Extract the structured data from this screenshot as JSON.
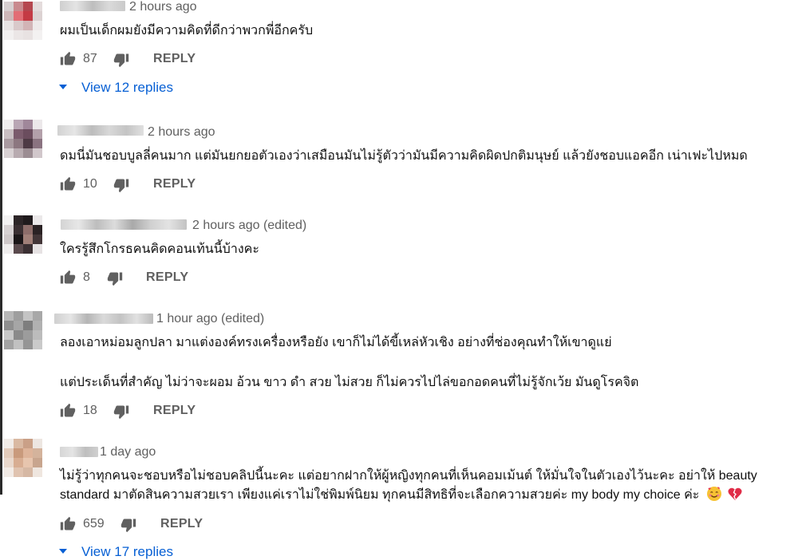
{
  "comments": [
    {
      "time": "2 hours ago",
      "text_lines": [
        "ผมเป็นเด็กผมยังมีความคิดที่ดีกว่าพวกพี่อีกครับ"
      ],
      "likes": "87",
      "reply_label": "REPLY",
      "view_replies": "View 12 replies"
    },
    {
      "time": "2 hours ago",
      "text_lines": [
        "ดมนี่มันชอบบูลลี่คนมาก แต่มันยกยอตัวเองว่าเสมือนมันไม่รู้ตัวว่ามันมีความคิดผิดปกติมนุษย์ แล้วยังชอบแอคอีก เน่าเฟะไปหมด"
      ],
      "likes": "10",
      "reply_label": "REPLY"
    },
    {
      "time": "2 hours ago (edited)",
      "text_lines": [
        "ใครรู้สึกโกรธคนคิดคอนเท้นนี้บ้างคะ"
      ],
      "likes": "8",
      "reply_label": "REPLY"
    },
    {
      "time": "1 hour ago (edited)",
      "text_lines": [
        "ลองเอาหม่อมลูกปลา มาแต่งองค์ทรงเครื่องหรือยัง เขาก็ไม่ได้ขี้เหล่หัวเชิง อย่างที่ช่องคุณทำให้เขาดูแย่",
        "แต่ประเด็นที่สำคัญ ไม่ว่าจะผอม อ้วน ขาว ดำ สวย ไม่สวย  ก็ไม่ควรไปไล่ขอกอดคนที่ไม่รู้จักเว้ย มันดูโรคจิต"
      ],
      "likes": "18",
      "reply_label": "REPLY"
    },
    {
      "time": "1 day ago",
      "text_lines": [
        "ไม่รู้ว่าทุกคนจะชอบหรือไม่ชอบคลิปนี้นะคะ แต่อยากฝากให้ผู้หญิงทุกคนที่เห็นคอมเม้นต์ ให้มั่นใจในตัวเองไว้นะคะ อย่าให้ beauty",
        "standard มาตัดสินความสวยเรา เพียงแค่เราไม่ใช่พิมพ์นิยม ทุกคนมีสิทธิที่จะเลือกความสวยค่ะ my body my choice ค่ะ"
      ],
      "likes": "659",
      "reply_label": "REPLY",
      "view_replies": "View 17 replies",
      "emojis": [
        "smiling-face-with-hearts-emoji",
        "broken-heart-emoji"
      ]
    }
  ],
  "colors": {
    "link": "#065fd4",
    "meta": "#606060",
    "text": "#0f0f0f"
  },
  "icons": [
    "thumb-up-icon",
    "thumb-down-icon",
    "caret-down-icon"
  ]
}
